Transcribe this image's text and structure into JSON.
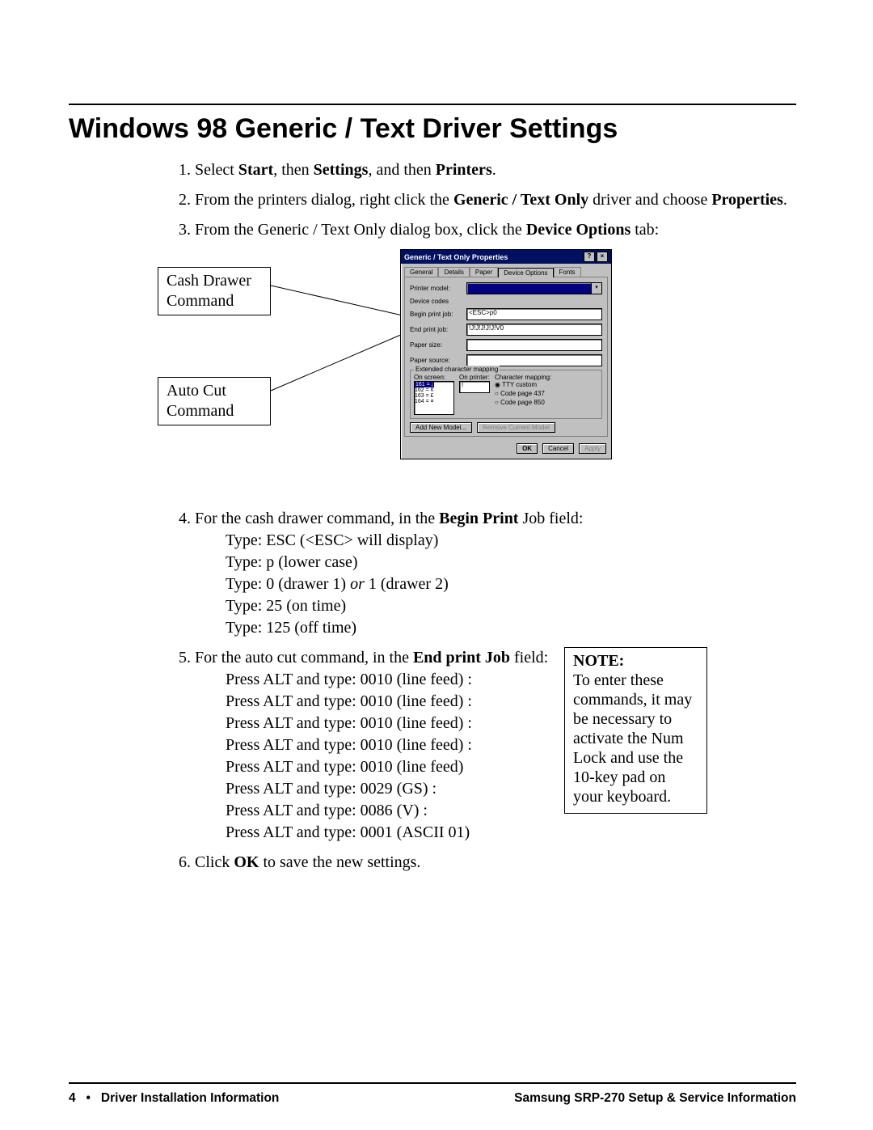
{
  "title": "Windows 98 Generic / Text Driver Settings",
  "steps": {
    "s1": {
      "pre": "Select ",
      "b1": "Start",
      "mid1": ", then ",
      "b2": "Settings",
      "mid2": ", and then ",
      "b3": "Printers",
      "post": "."
    },
    "s2": {
      "pre": "From the printers dialog, right click the ",
      "b1": "Generic / Text Only",
      "mid": " driver and choose ",
      "b2": "Properties",
      "post": "."
    },
    "s3": {
      "pre": "From the Generic / Text Only dialog box, click the ",
      "b1": "Device Options",
      "post": " tab:"
    },
    "s4": {
      "pre": "For the cash drawer command, in the ",
      "b1": "Begin Print",
      "post": " Job field:",
      "l1a": "Type:  ESC  (<ESC> will display)",
      "l1b": "Type:  p   (lower case)",
      "l1c_pre": "Type:  0   (drawer 1) ",
      "l1c_i": "or",
      "l1c_post": " 1 (drawer 2)",
      "l1d": "Type: 25   (on time)",
      "l1e": "Type: 125   (off time)"
    },
    "s5": {
      "pre": "For the auto cut command, in the ",
      "b1": "End print Job",
      "post": " field:",
      "l1": "Press ALT and type:  0010 (line feed) :",
      "l2": "Press ALT and type:  0010 (line feed) :",
      "l3": "Press ALT and type:  0010 (line feed) :",
      "l4": "Press ALT and type:  0010 (line feed) :",
      "l5": "Press ALT and type:  0010 (line feed)",
      "l6": "Press ALT and type:  0029 (GS) :",
      "l7": "Press ALT and type:  0086 (V) :",
      "l8": "Press ALT and type:  0001 (ASCII 01)"
    },
    "s6": {
      "pre": "Click ",
      "b1": "OK",
      "post": " to save the new settings."
    }
  },
  "callouts": {
    "cash": "Cash Drawer Command",
    "autocut": "Auto Cut Command"
  },
  "note": {
    "heading": "NOTE:",
    "body": "To enter these commands, it may be necessary to activate the Num Lock and use the 10-key pad on your keyboard."
  },
  "dialog": {
    "title": "Generic / Text Only Properties",
    "help_btn": "?",
    "close_btn": "×",
    "tabs": [
      "General",
      "Details",
      "Paper",
      "Device Options",
      "Fonts"
    ],
    "active_tab": 3,
    "labels": {
      "printer_model": "Printer model:",
      "device_codes": "Device codes",
      "begin": "Begin print job:",
      "end": "End print job:",
      "paper_size": "Paper size:",
      "paper_source": "Paper source:",
      "ext_group": "Extended character mapping",
      "on_screen": "On screen:",
      "on_printer": "On printer:",
      "char_map": "Character mapping:",
      "r_tty": "TTY custom",
      "r_437": "Code page 437",
      "r_850": "Code page 850",
      "add": "Add New Model...",
      "remove": "Remove Current Model",
      "ok": "OK",
      "cancel": "Cancel",
      "apply": "Apply"
    },
    "values": {
      "printer_model": "",
      "begin": "<ESC>p0",
      "end": "!J!J!J!J!J!V0",
      "paper_size": "",
      "paper_source": "",
      "on_printer": "!",
      "list": [
        "161 = ¡",
        "162 = ¢",
        "163 = £",
        "164 = ¤"
      ]
    }
  },
  "footer": {
    "left_page": "4",
    "left_bullet": "•",
    "left_text": "Driver Installation Information",
    "right": "Samsung SRP-270 Setup & Service Information"
  }
}
